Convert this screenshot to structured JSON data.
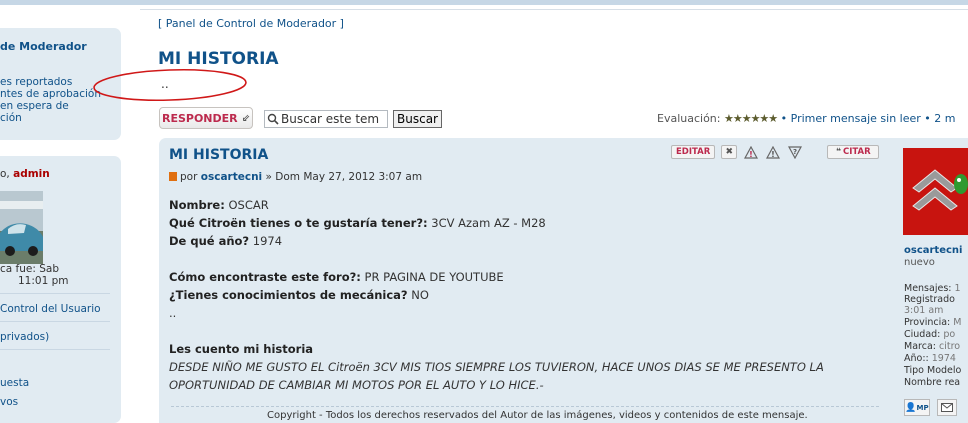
{
  "sidebar": {
    "panel1": {
      "title": "de Moderador",
      "items": [
        "es reportados",
        "ntes de aprobación",
        "en espera de",
        "ción"
      ]
    },
    "panel2": {
      "greeting_prefix": "o, ",
      "username": "admin",
      "last_visit_line1": "ca fue: Sab",
      "last_visit_line2": "11:01 pm",
      "links": [
        "Control del Usuario",
        "privados)",
        "uesta",
        "vos"
      ]
    }
  },
  "breadcrumb": "[ Panel de Control de Moderador ]",
  "page_title": "MI HISTORIA",
  "page_excerpt": "..",
  "toolbar": {
    "reply_label": "RESPONDER",
    "search_placeholder": "Buscar este tem",
    "search_button": "Buscar",
    "rating_label": "Evaluación:",
    "rating_stars": "★★★★★★",
    "first_unread": "• Primer mensaje sin leer",
    "pagination": "• 2 m"
  },
  "post": {
    "title": "MI HISTORIA",
    "buttons": {
      "edit": "EDITAR",
      "delete": "✖",
      "warn": "!",
      "report": "!",
      "info": "?",
      "quote": "CITAR"
    },
    "meta_prefix": "por",
    "author": "oscartecni",
    "date": "» Dom May 27, 2012 3:07 am",
    "lines": [
      {
        "label": "Nombre:",
        "value": " OSCAR"
      },
      {
        "label": "Qué Citroën tienes o te gustaría tener?:",
        "value": " 3CV Azam AZ - M28"
      },
      {
        "label": "De qué año?",
        "value": " 1974"
      },
      {
        "label": "Cómo encontraste este foro?:",
        "value": " PR PAGINA DE YOUTUBE"
      },
      {
        "label": "¿Tienes conocimientos de mecánica?",
        "value": " NO"
      }
    ],
    "dots": "..",
    "story_title": "Les cuento mi historia",
    "story_line1": "DESDE NIÑO ME GUSTO EL Citroën 3CV MIS TIOS SIEMPRE LOS TUVIERON, HACE UNOS DIAS SE ME PRESENTO LA",
    "story_line2": "OPORTUNIDAD DE CAMBIAR MI MOTOS POR EL AUTO Y LO HICE.-",
    "copyright": "Copyright - Todos los derechos reservados del Autor de las imágenes, videos y contenidos de este mensaje."
  },
  "profile": {
    "name": "oscartecni",
    "rank": "nuevo",
    "fields": [
      {
        "k": "Mensajes: ",
        "v": "1"
      },
      {
        "k": "Registrado",
        "v": ""
      },
      {
        "k": "",
        "v": "3:01 am"
      },
      {
        "k": "Provincia: ",
        "v": "M"
      },
      {
        "k": "Ciudad: ",
        "v": "po"
      },
      {
        "k": "Marca: ",
        "v": "citro"
      },
      {
        "k": "Año:: ",
        "v": "1974"
      },
      {
        "k": "Tipo Modelo",
        "v": ""
      },
      {
        "k": "Nombre rea",
        "v": ""
      }
    ],
    "pm_label": "MP"
  },
  "colors": {
    "link": "#105289",
    "panel_bg": "#e1ebf2",
    "accent_red": "#bc2a4d",
    "annotation_red": "#d01818"
  }
}
